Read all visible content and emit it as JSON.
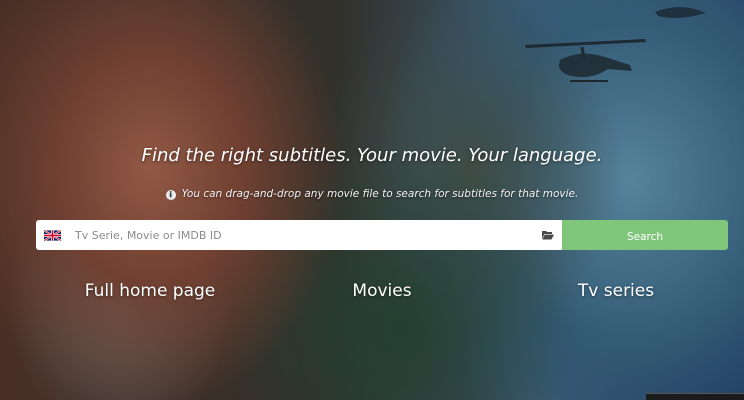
{
  "hero": {
    "tagline": "Find the right subtitles. Your movie. Your language.",
    "hint": "You can drag-and-drop any movie file to search for subtitles for that movie."
  },
  "search": {
    "language_flag": "uk-flag-icon",
    "placeholder": "Tv Serie, Movie or IMDB ID",
    "value": "",
    "folder_icon": "folder-open-icon",
    "button_label": "Search"
  },
  "nav": {
    "links": [
      {
        "label": "Full home page"
      },
      {
        "label": "Movies"
      },
      {
        "label": "Tv series"
      }
    ]
  },
  "colors": {
    "search_button": "#7fc67b",
    "text": "#ffffff"
  }
}
